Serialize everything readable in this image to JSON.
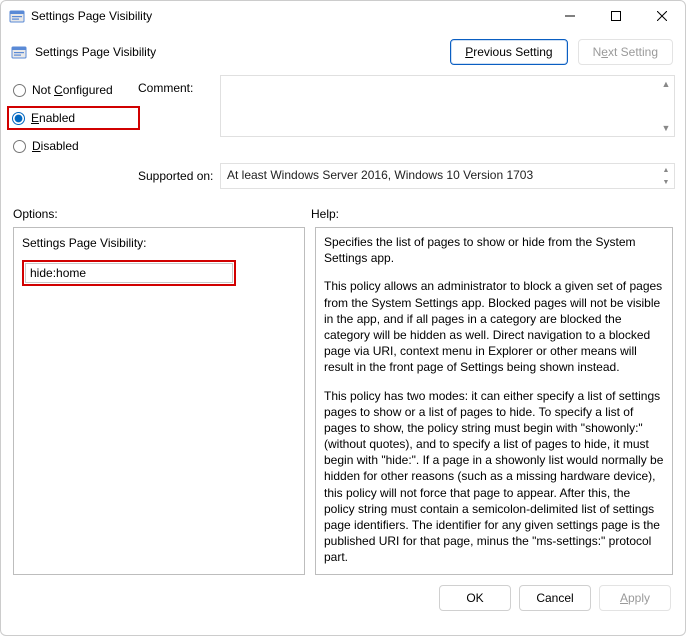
{
  "window": {
    "title": "Settings Page Visibility"
  },
  "header": {
    "title": "Settings Page Visibility",
    "prev": "Previous Setting",
    "next_pre": "N",
    "next_u": "e",
    "next_post": "xt Setting"
  },
  "state": {
    "not_configured_pre": "Not ",
    "not_configured_u": "C",
    "not_configured_post": "onfigured",
    "enabled_u": "E",
    "enabled_post": "nabled",
    "disabled_u": "D",
    "disabled_post": "isabled",
    "selected": "enabled"
  },
  "labels": {
    "comment": "Comment:",
    "supported": "Supported on:",
    "options": "Options:",
    "help": "Help:"
  },
  "supported_text": "At least Windows Server 2016, Windows 10 Version 1703",
  "options_panel": {
    "field_label": "Settings Page Visibility:",
    "field_value": "hide:home"
  },
  "help": {
    "p1": "Specifies the list of pages to show or hide from the System Settings app.",
    "p2": "This policy allows an administrator to block a given set of pages from the System Settings app. Blocked pages will not be visible in the app, and if all pages in a category are blocked the category will be hidden as well. Direct navigation to a blocked page via URI, context menu in Explorer or other means will result in the front page of Settings being shown instead.",
    "p3": "This policy has two modes: it can either specify a list of settings pages to show or a list of pages to hide. To specify a list of pages to show, the policy string must begin with \"showonly:\" (without quotes), and to specify a list of pages to hide, it must begin with \"hide:\". If a page in a showonly list would normally be hidden for other reasons (such as a missing hardware device), this policy will not force that page to appear. After this, the policy string must contain a semicolon-delimited list of settings page identifiers. The identifier for any given settings page is the published URI for that page, minus the \"ms-settings:\" protocol part."
  },
  "footer": {
    "ok": "OK",
    "cancel": "Cancel",
    "apply_u": "A",
    "apply_post": "pply"
  }
}
